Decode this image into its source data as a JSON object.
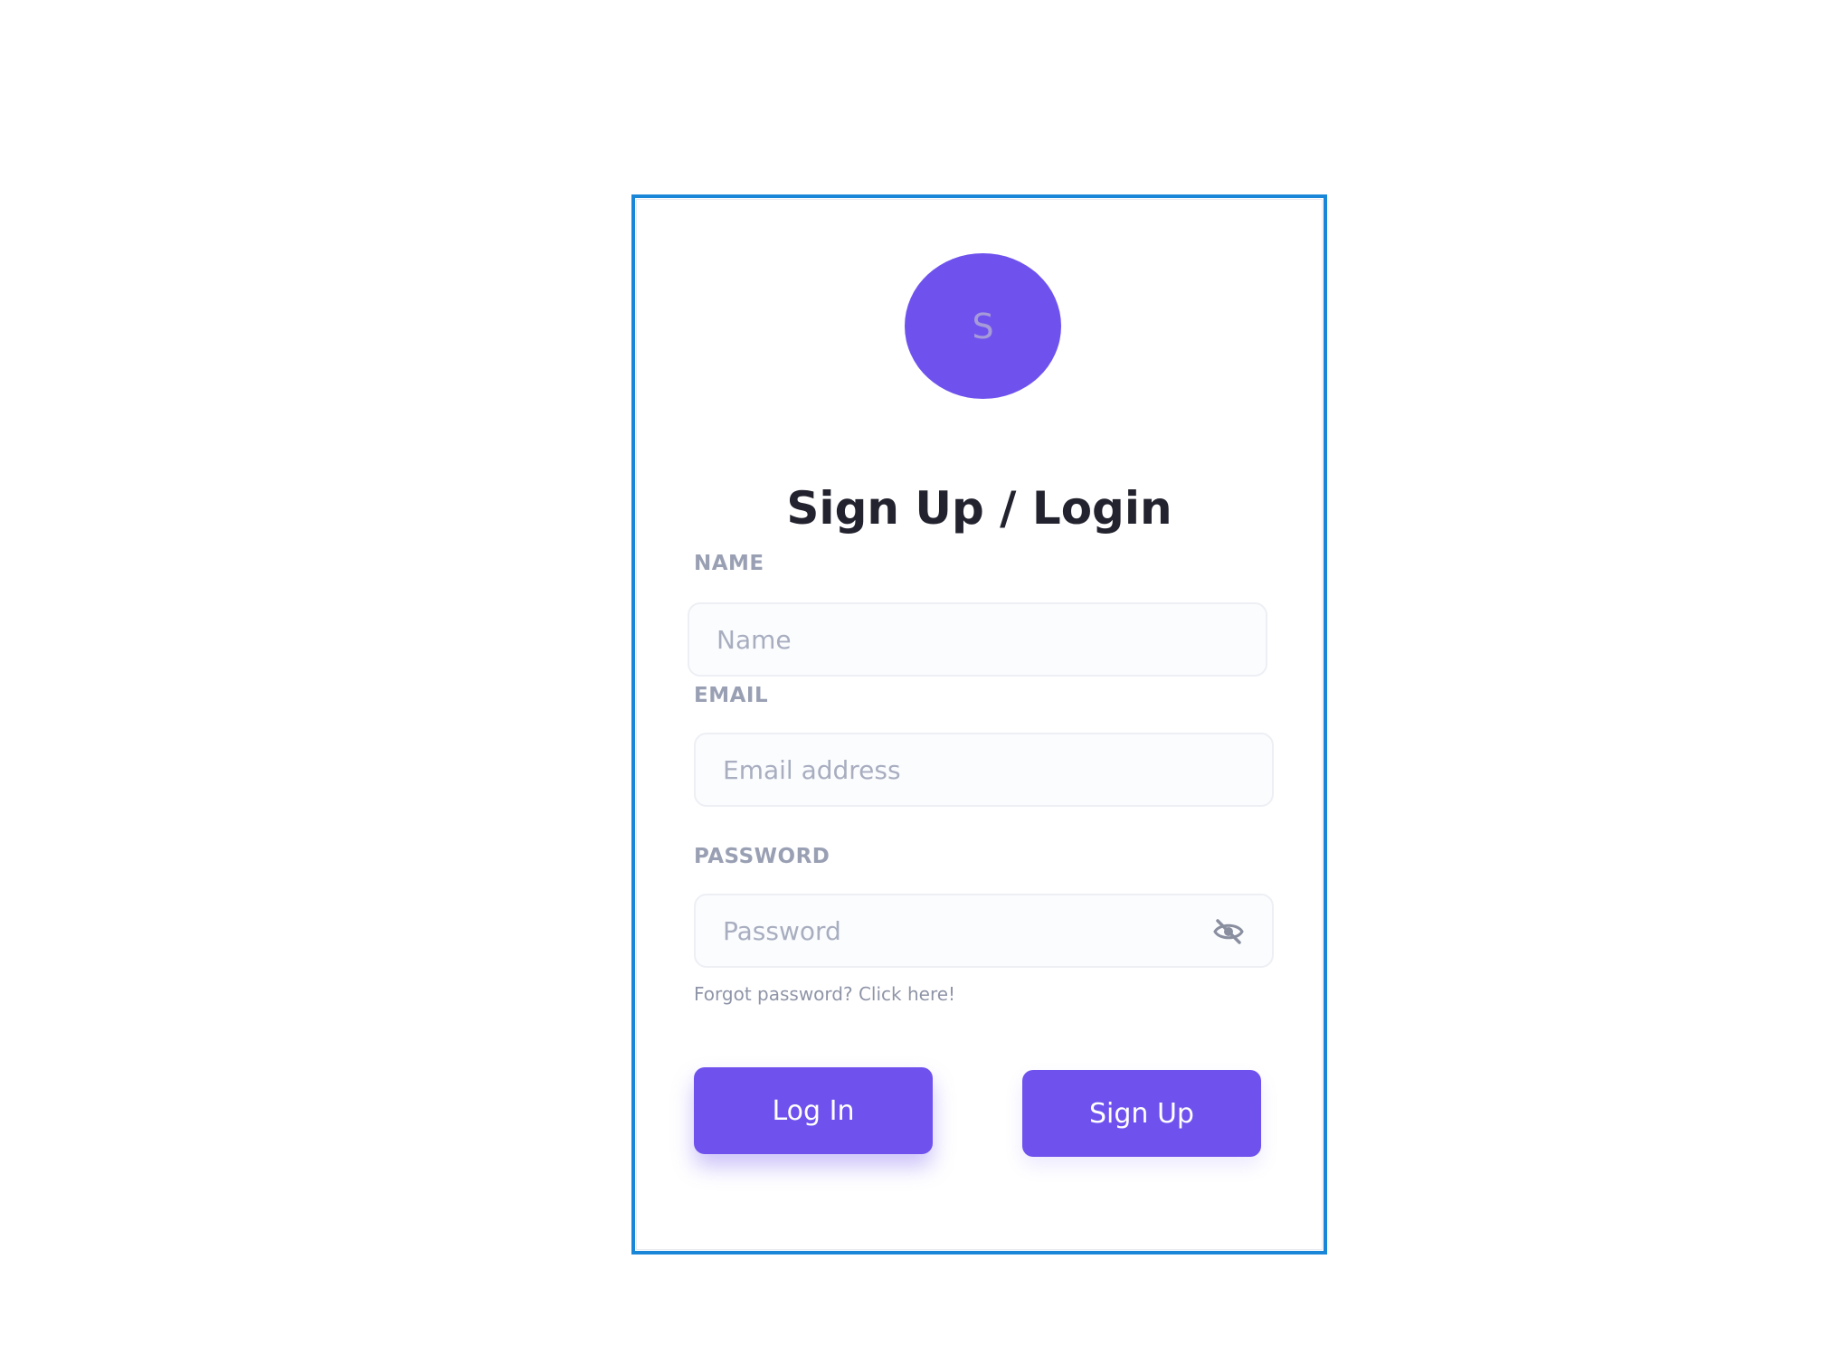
{
  "avatar": {
    "initial": "S"
  },
  "title": "Sign Up / Login",
  "name_field": {
    "label": "NAME",
    "placeholder": "Name",
    "value": ""
  },
  "email_field": {
    "label": "EMAIL",
    "placeholder": "Email address",
    "value": ""
  },
  "password_field": {
    "label": "PASSWORD",
    "placeholder": "Password",
    "value": "",
    "toggle_icon": "eye-off-icon"
  },
  "forgot_link": "Forgot password? Click here!",
  "buttons": {
    "login": "Log In",
    "signup": "Sign Up"
  },
  "colors": {
    "accent": "#6f52ed",
    "card_border": "#1a86d8",
    "title": "#23232f",
    "label": "#9aa0b4"
  }
}
